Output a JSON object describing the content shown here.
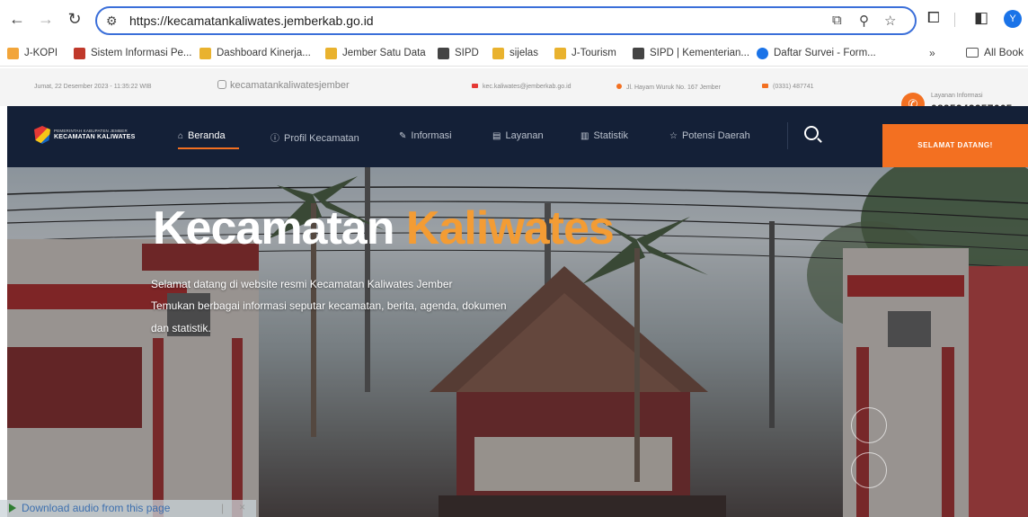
{
  "browser": {
    "url": "https://kecamatankaliwates.jemberkab.go.id",
    "profile_initial": "Y",
    "bookmarks": [
      {
        "label": "J-KOPI",
        "color": "#f2a53a"
      },
      {
        "label": "Sistem Informasi Pe...",
        "color": "#c0392b"
      },
      {
        "label": "Dashboard Kinerja...",
        "color": "#e9b22e"
      },
      {
        "label": "Jember Satu Data",
        "color": "#e9b22e"
      },
      {
        "label": "SIPD",
        "color": "#444444"
      },
      {
        "label": "sijelas",
        "color": "#e9b22e"
      },
      {
        "label": "J-Tourism",
        "color": "#e9b22e"
      },
      {
        "label": "SIPD | Kementerian...",
        "color": "#444444"
      },
      {
        "label": "Daftar Survei - Form...",
        "color": "#1a73e8"
      }
    ],
    "more_label": "»",
    "all_bookmarks": "All Book"
  },
  "topbar": {
    "date": "Jumat, 22 Desember 2023 - 11:35:22 WIB",
    "instagram": "kecamatankaliwatesjember",
    "email": "kec.kaliwates@jemberkab.go.id",
    "address": "Jl. Hayam Wuruk No. 167 Jember",
    "phone": "(0331) 487741",
    "layanan_label": "Layanan Informasi",
    "layanan_phone": "0895343357665"
  },
  "logo": {
    "small": "PEMERINTAH KABUPATEN JEMBER",
    "big": "KECAMATAN KALIWATES"
  },
  "nav": {
    "items": [
      {
        "label": "Beranda",
        "icon": "home-icon"
      },
      {
        "label": "Profil Kecamatan",
        "icon": "info-icon"
      },
      {
        "label": "Informasi",
        "icon": "megaphone-icon"
      },
      {
        "label": "Layanan",
        "icon": "document-icon"
      },
      {
        "label": "Statistik",
        "icon": "chart-icon"
      },
      {
        "label": "Potensi Daerah",
        "icon": "star-icon"
      }
    ],
    "welcome": "SELAMAT DATANG!"
  },
  "hero": {
    "title_white": "Kecamatan",
    "title_orange": "Kaliwates",
    "line1": "Selamat datang di website resmi Kecamatan Kaliwates Jember",
    "line2": "Temukan berbagai informasi seputar kecamatan, berita, agenda, dokumen",
    "line3": "dan statistik."
  },
  "audio": {
    "label": "Download audio from this page"
  },
  "colors": {
    "accent": "#f37021",
    "nav_bg": "#142037",
    "title_orange": "#f39c34"
  }
}
